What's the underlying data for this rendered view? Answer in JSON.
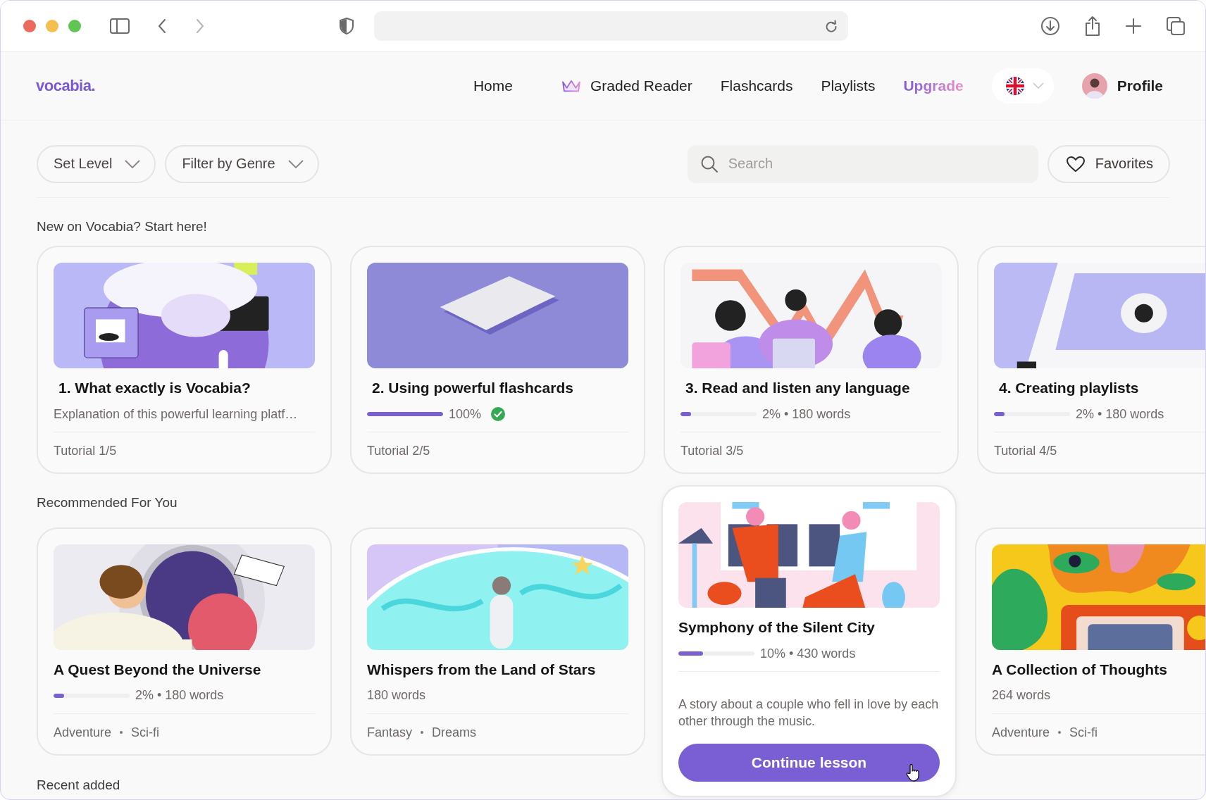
{
  "nav": {
    "logo": "vocabia.",
    "links": [
      {
        "label": "Home",
        "kind": "plain"
      },
      {
        "label": "Graded Reader",
        "kind": "premium"
      },
      {
        "label": "Flashcards",
        "kind": "plain"
      },
      {
        "label": "Playlists",
        "kind": "plain"
      },
      {
        "label": "Upgrade",
        "kind": "upgrade"
      }
    ],
    "profile": "Profile"
  },
  "filters": [
    {
      "label": "Set Level"
    },
    {
      "label": "Filter by Genre"
    }
  ],
  "search": {
    "placeholder": "Search"
  },
  "favorites": {
    "label": "Favorites"
  },
  "sections": [
    {
      "title": "New on Vocabia? Start here!",
      "cards": [
        {
          "title": "1. What exactly is Vocabia?",
          "description": "Explanation of this powerful learning platf…",
          "footer": "Tutorial 1/5",
          "hovered": false
        },
        {
          "title": "2. Using powerful flashcards",
          "progress": {
            "level": 1,
            "reading": "100%",
            "completed": true
          },
          "footer": "Tutorial 2/5",
          "hovered": false
        },
        {
          "title": "3. Read and listen any language",
          "progress": {
            "level": 0.14,
            "reading": "2% • 180 words",
            "completed": false
          },
          "footer": "Tutorial 3/5",
          "hovered": false
        },
        {
          "title": "4. Creating playlists",
          "progress": {
            "level": 0.14,
            "reading": "2% • 180 words",
            "completed": false
          },
          "footer": "Tutorial 4/5",
          "hovered": false
        }
      ]
    },
    {
      "title": "Recommended For You",
      "cards": [
        {
          "title": "A Quest Beyond the Universe",
          "progress": {
            "level": 0.14,
            "reading": "2% • 180 words",
            "completed": false
          },
          "tags": [
            "Adventure",
            "Sci-fi"
          ],
          "hovered": false
        },
        {
          "title": "Whispers from the Land of Stars",
          "meta": "180 words",
          "tags": [
            "Fantasy",
            "Dreams"
          ],
          "hovered": false
        },
        {
          "title": "Symphony of the Silent City",
          "progress": {
            "level": 0.32,
            "reading": "10% • 430 words",
            "completed": false
          },
          "description": "A story about a couple who fell in love by each other through the music.",
          "button": "Continue lesson",
          "hovered": true
        },
        {
          "title": "A Collection of Thoughts",
          "meta": "264 words",
          "tags": [
            "Adventure",
            "Sci-fi"
          ],
          "hovered": false
        }
      ]
    }
  ],
  "recent": {
    "title": "Recent added"
  }
}
